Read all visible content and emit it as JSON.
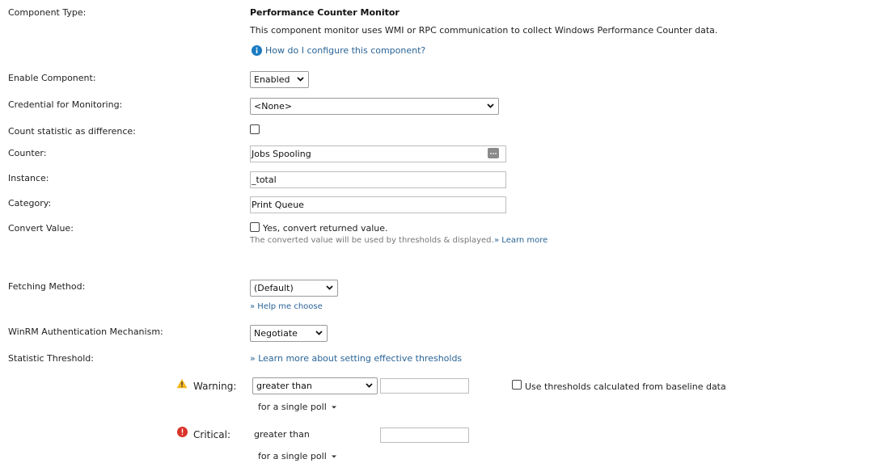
{
  "labels": {
    "component_type": "Component Type:",
    "enable_component": "Enable Component:",
    "credential": "Credential for Monitoring:",
    "count_statistic": "Count statistic as difference:",
    "counter": "Counter:",
    "instance": "Instance:",
    "category": "Category:",
    "convert_value": "Convert Value:",
    "fetching_method": "Fetching Method:",
    "winrm_auth": "WinRM Authentication Mechanism:",
    "statistic_threshold": "Statistic Threshold:"
  },
  "component": {
    "title": "Performance Counter Monitor",
    "description": "This component monitor uses WMI or RPC communication to collect Windows Performance Counter data.",
    "help_link": "How do I configure this component?"
  },
  "fields": {
    "enable_component": "Enabled",
    "credential": "<None>",
    "counter": "Jobs Spooling",
    "instance": "_total",
    "category": "Print Queue",
    "convert_checkbox_label": "Yes, convert returned value.",
    "convert_note": "The converted value will be used by thresholds & displayed.",
    "convert_learn_more": "» Learn more",
    "fetching_method": "(Default)",
    "fetching_help": "» Help me choose",
    "winrm_auth": "Negotiate",
    "thresholds_link": "» Learn more about setting effective thresholds"
  },
  "thresholds": {
    "warning": {
      "label": "Warning:",
      "operator": "greater than",
      "value": "",
      "poll": "for a single poll",
      "baseline_label": "Use thresholds calculated from baseline data"
    },
    "critical": {
      "label": "Critical:",
      "operator": "greater than",
      "value": "",
      "poll": "for a single poll"
    }
  },
  "colors": {
    "link": "#2a6496",
    "info_icon": "#1a7bc1",
    "warning_icon": "#f3b61f",
    "critical_icon": "#d9342b"
  }
}
